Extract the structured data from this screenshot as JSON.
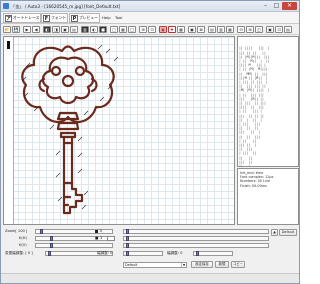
{
  "window": {
    "title": "「金」 / Auto3 - [16620545_m.jpg] [font_Default.txt]",
    "minimize": "–",
    "maximize": "□",
    "close": "✕"
  },
  "menubar": {
    "tabs": [
      {
        "icon": "ア",
        "label": "オートトレース"
      },
      {
        "icon": "F",
        "label": "フォント"
      },
      {
        "icon": "P",
        "label": "プレビュー"
      }
    ],
    "plain": [
      "Help",
      "Tool"
    ]
  },
  "toolbar": {
    "buttons": [
      "📂",
      "💾",
      "▶",
      "◀",
      "◧",
      "◨",
      "▣",
      "▤",
      "▥",
      "◐",
      "■",
      "▢",
      "▦",
      "◯",
      "⊞",
      "⊡",
      "▣",
      "✚",
      "▦",
      "▣",
      "⊠",
      "▤",
      "▥",
      "▦",
      "⊟",
      "⊞",
      "◫",
      "▣",
      "⊡",
      "▤"
    ]
  },
  "canvas": {
    "image": "key-outline"
  },
  "text_panel": {
    "lines": [
      "|| ||||   |||  |",
      "||| || ||   ||",
      "|| |M||M|||  |||",
      "| ||  M||  |  ||",
      "|||| M   ||| |",
      "| || |M|  M||||",
      "||  MM| ||  |||",
      "|||M || |M||  |",
      "| ||| || |||  |",
      "||  ||| ||| ||",
      "|M| |M|| ||||  |",
      "| ||  ||| |||",
      "|||   |M|| ||",
      "|| |||  || |||",
      "||||  ||  |||",
      "| ||   ||| |",
      "|||  || || ||",
      "||  |  ||  |",
      "| |||   |||",
      "||  ||  ||",
      "|||   ||  |",
      "||  ||  |||",
      "| ||   ||",
      "||| ||  |",
      "||  |||",
      "| |||  ||",
      "||   ||",
      "|||  ||",
      "||   |",
      "|"
    ]
  },
  "info_panel": {
    "lines": [
      "Init_end: time",
      "Font complex: 12px",
      "Numbers: 00 Line",
      "Finish: 0X-00ms"
    ]
  },
  "controls": {
    "zoom_label": "Zoom[ 100 ]",
    "kh_label": "K(H)",
    "kv_label": "K(V)",
    "line_width_label": "変更幅調整: [ 0 ]",
    "char_width_label": "幅調整: 0",
    "line_label": "幅調整: 0",
    "square_glyph": "■",
    "ratio_a": "0",
    "ratio_b": "3",
    "default_button": "Default",
    "preset_select": "Default",
    "btn_apply": "設定保存",
    "btn_load": "新規",
    "btn_copy": "コピー"
  }
}
